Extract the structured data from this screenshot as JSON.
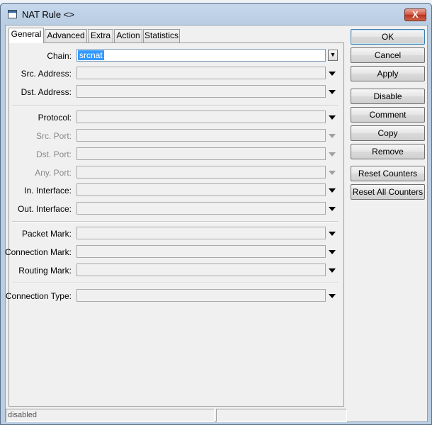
{
  "window": {
    "title": "NAT Rule <>",
    "close_label": "X"
  },
  "tabs": [
    "General",
    "Advanced",
    "Extra",
    "Action",
    "Statistics"
  ],
  "form": {
    "chain": {
      "label": "Chain:",
      "value": "srcnat"
    },
    "src_address": {
      "label": "Src. Address:"
    },
    "dst_address": {
      "label": "Dst. Address:"
    },
    "protocol": {
      "label": "Protocol:"
    },
    "src_port": {
      "label": "Src. Port:"
    },
    "dst_port": {
      "label": "Dst. Port:"
    },
    "any_port": {
      "label": "Any. Port:"
    },
    "in_interface": {
      "label": "In. Interface:"
    },
    "out_interface": {
      "label": "Out. Interface:"
    },
    "packet_mark": {
      "label": "Packet Mark:"
    },
    "connection_mark": {
      "label": "Connection Mark:"
    },
    "routing_mark": {
      "label": "Routing Mark:"
    },
    "connection_type": {
      "label": "Connection Type:"
    }
  },
  "buttons": {
    "ok": "OK",
    "cancel": "Cancel",
    "apply": "Apply",
    "disable": "Disable",
    "comment": "Comment",
    "copy": "Copy",
    "remove": "Remove",
    "reset_counters": "Reset Counters",
    "reset_all_counters": "Reset All Counters"
  },
  "status": {
    "left": "disabled",
    "right": ""
  },
  "colors": {
    "selection": "#3399ff",
    "title_bar": "#b9cde3",
    "close_button": "#d0513c"
  }
}
